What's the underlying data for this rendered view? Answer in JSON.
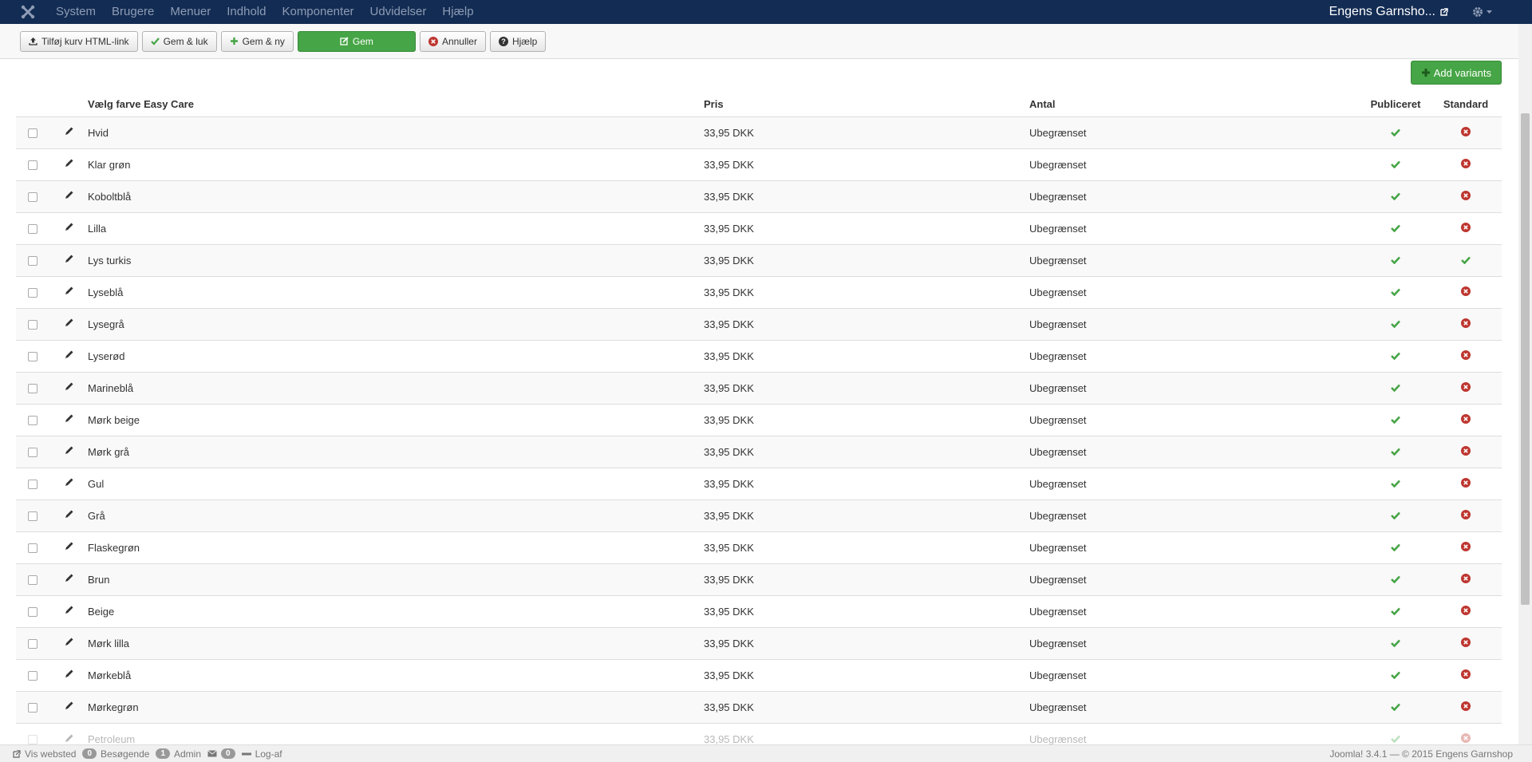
{
  "navbar": {
    "menu": [
      "System",
      "Brugere",
      "Menuer",
      "Indhold",
      "Komponenter",
      "Udvidelser",
      "Hjælp"
    ],
    "site_name": "Engens Garnsho..."
  },
  "toolbar": {
    "add_link_label": "Tilføj kurv HTML-link",
    "save_close_label": "Gem & luk",
    "save_new_label": "Gem & ny",
    "save_label": "Gem",
    "cancel_label": "Annuller",
    "help_label": "Hjælp"
  },
  "add_variants_label": "Add variants",
  "table": {
    "headers": {
      "name": "Vælg farve Easy Care",
      "price": "Pris",
      "quantity": "Antal",
      "published": "Publiceret",
      "default": "Standard"
    },
    "rows": [
      {
        "name": "Hvid",
        "price": "33,95 DKK",
        "quantity": "Ubegrænset",
        "published": true,
        "default": false
      },
      {
        "name": "Klar grøn",
        "price": "33,95 DKK",
        "quantity": "Ubegrænset",
        "published": true,
        "default": false
      },
      {
        "name": "Koboltblå",
        "price": "33,95 DKK",
        "quantity": "Ubegrænset",
        "published": true,
        "default": false
      },
      {
        "name": "Lilla",
        "price": "33,95 DKK",
        "quantity": "Ubegrænset",
        "published": true,
        "default": false
      },
      {
        "name": "Lys turkis",
        "price": "33,95 DKK",
        "quantity": "Ubegrænset",
        "published": true,
        "default": true
      },
      {
        "name": "Lyseblå",
        "price": "33,95 DKK",
        "quantity": "Ubegrænset",
        "published": true,
        "default": false
      },
      {
        "name": "Lysegrå",
        "price": "33,95 DKK",
        "quantity": "Ubegrænset",
        "published": true,
        "default": false
      },
      {
        "name": "Lyserød",
        "price": "33,95 DKK",
        "quantity": "Ubegrænset",
        "published": true,
        "default": false
      },
      {
        "name": "Marineblå",
        "price": "33,95 DKK",
        "quantity": "Ubegrænset",
        "published": true,
        "default": false
      },
      {
        "name": "Mørk beige",
        "price": "33,95 DKK",
        "quantity": "Ubegrænset",
        "published": true,
        "default": false
      },
      {
        "name": "Mørk grå",
        "price": "33,95 DKK",
        "quantity": "Ubegrænset",
        "published": true,
        "default": false
      },
      {
        "name": "Gul",
        "price": "33,95 DKK",
        "quantity": "Ubegrænset",
        "published": true,
        "default": false
      },
      {
        "name": "Grå",
        "price": "33,95 DKK",
        "quantity": "Ubegrænset",
        "published": true,
        "default": false
      },
      {
        "name": "Flaskegrøn",
        "price": "33,95 DKK",
        "quantity": "Ubegrænset",
        "published": true,
        "default": false
      },
      {
        "name": "Brun",
        "price": "33,95 DKK",
        "quantity": "Ubegrænset",
        "published": true,
        "default": false
      },
      {
        "name": "Beige",
        "price": "33,95 DKK",
        "quantity": "Ubegrænset",
        "published": true,
        "default": false
      },
      {
        "name": "Mørk lilla",
        "price": "33,95 DKK",
        "quantity": "Ubegrænset",
        "published": true,
        "default": false
      },
      {
        "name": "Mørkeblå",
        "price": "33,95 DKK",
        "quantity": "Ubegrænset",
        "published": true,
        "default": false
      },
      {
        "name": "Mørkegrøn",
        "price": "33,95 DKK",
        "quantity": "Ubegrænset",
        "published": true,
        "default": false
      },
      {
        "name": "Petroleum",
        "price": "33,95 DKK",
        "quantity": "Ubegrænset",
        "published": true,
        "default": false
      }
    ]
  },
  "statusbar": {
    "view_site_label": "Vis websted",
    "visitors_count": "0",
    "visitors_label": "Besøgende",
    "admin_count": "1",
    "admin_label": "Admin",
    "messages_count": "0",
    "logout_label": "Log-af",
    "version_text": "Joomla! 3.4.1 — © 2015 Engens Garnshop"
  },
  "colors": {
    "navbar_bg": "#132c53",
    "success_green": "#46a546",
    "check_green": "#46a546",
    "cross_red": "#bd362f"
  }
}
